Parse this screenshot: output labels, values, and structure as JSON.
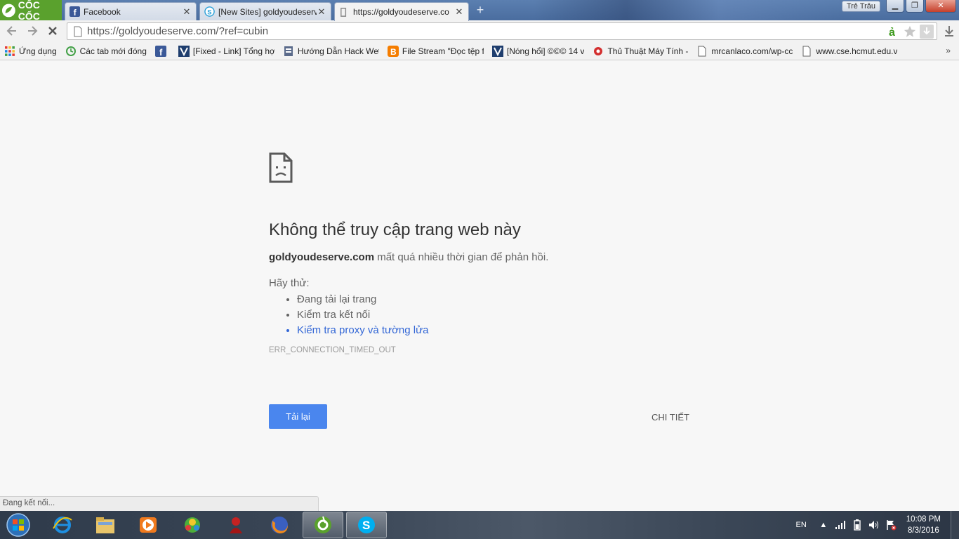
{
  "browser": {
    "brand": "CỐC CỐC",
    "tabs": [
      {
        "title": "Facebook",
        "favicon": "facebook-icon"
      },
      {
        "title": "[New Sites] goldyoudeserve",
        "favicon": "skype-icon"
      },
      {
        "title": "https://goldyoudeserve.co",
        "favicon": "page-icon"
      }
    ],
    "user_label": "Trẻ Trâu",
    "url": "https://goldyoudeserve.com/?ref=cubin"
  },
  "bookmarks": [
    {
      "label": "Ứng dụng",
      "icon": "apps-grid-icon"
    },
    {
      "label": "Các tab mới đóng",
      "icon": "history-icon"
    },
    {
      "label": "",
      "icon": "facebook-icon"
    },
    {
      "label": "[Fixed - Link] Tổng hợ",
      "icon": "vforum-icon"
    },
    {
      "label": "Hướng Dẫn Hack Wet",
      "icon": "doc-icon"
    },
    {
      "label": "File Stream \"Đọc tệp f",
      "icon": "blogger-icon"
    },
    {
      "label": "[Nóng hổi] ©©© 14 v",
      "icon": "vforum-icon"
    },
    {
      "label": "Thủ Thuật Máy Tính -",
      "icon": "red-icon"
    },
    {
      "label": "mrcanlaco.com/wp-cc",
      "icon": "page-icon"
    },
    {
      "label": "www.cse.hcmut.edu.v",
      "icon": "page-icon"
    }
  ],
  "error": {
    "title": "Không thể truy cập trang web này",
    "domain": "goldyoudeserve.com",
    "desc_suffix": " mất quá nhiều thời gian để phản hồi.",
    "try_label": "Hãy thử:",
    "suggestions": [
      "Đang tải lại trang",
      "Kiểm tra kết nối",
      "Kiểm tra proxy và tường lửa"
    ],
    "code": "ERR_CONNECTION_TIMED_OUT",
    "reload_label": "Tải lại",
    "details_label": "CHI TIẾT"
  },
  "status_text": "Đang kết nối...",
  "taskbar": {
    "apps": [
      "internet-explorer-icon",
      "file-explorer-icon",
      "media-player-icon",
      "messenger-bird-icon",
      "red-character-icon",
      "firefox-icon",
      "coccoc-icon",
      "skype-icon"
    ],
    "language": "EN",
    "time": "10:08 PM",
    "date": "8/3/2016"
  },
  "colors": {
    "link": "#3367d6",
    "reload_button": "#4a86ee",
    "brand_green": "#5aa12d"
  }
}
